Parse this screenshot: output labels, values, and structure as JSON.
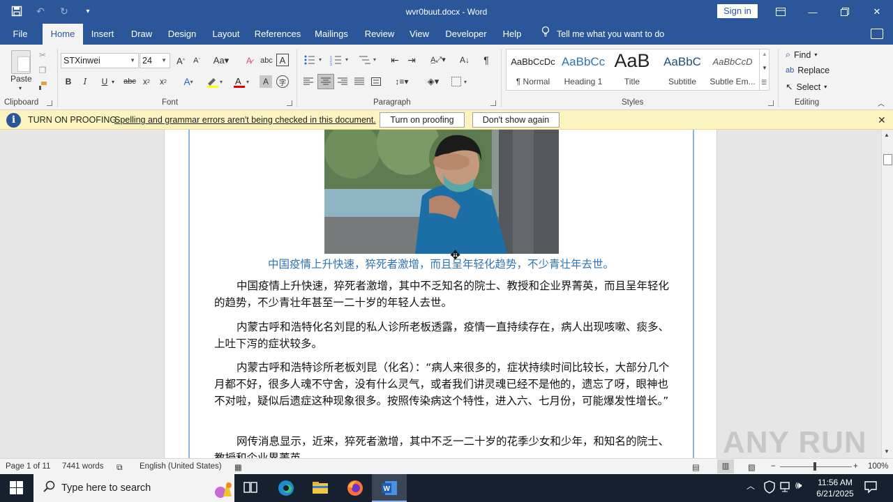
{
  "app": {
    "title": "wvr0buut.docx  -  Word",
    "sign_in": "Sign in"
  },
  "tabs": [
    "File",
    "Home",
    "Insert",
    "Draw",
    "Design",
    "Layout",
    "References",
    "Mailings",
    "Review",
    "View",
    "Developer",
    "Help"
  ],
  "tell_me": "Tell me what you want to do",
  "ribbon": {
    "clipboard": {
      "paste": "Paste",
      "label": "Clipboard"
    },
    "font": {
      "name": "STXinwei",
      "size": "24",
      "label": "Font"
    },
    "paragraph": {
      "label": "Paragraph"
    },
    "styles": {
      "label": "Styles",
      "items": [
        {
          "preview": "AaBbCcDc",
          "name": "¶ Normal"
        },
        {
          "preview": "AaBbCc",
          "name": "Heading 1"
        },
        {
          "preview": "AaB",
          "name": "Title"
        },
        {
          "preview": "AaBbC",
          "name": "Subtitle"
        },
        {
          "preview": "AaBbCcD",
          "name": "Subtle Em..."
        }
      ]
    },
    "editing": {
      "label": "Editing",
      "find": "Find",
      "replace": "Replace",
      "select": "Select"
    }
  },
  "notification": {
    "title": "TURN ON PROOFING",
    "text": "Spelling and grammar errors aren't being checked in this document.",
    "turn_on": "Turn on proofing",
    "dont_show": "Don't show again"
  },
  "document": {
    "caption": "中国疫情上升快速，猝死者激增，而且呈年轻化趋势，不少青壮年去世。",
    "paragraphs": [
      "中国疫情上升快速，猝死者激增，其中不乏知名的院士、教授和企业界菁英，而且呈年轻化的趋势，不少青壮年甚至一二十岁的年轻人去世。",
      "内蒙古呼和浩特化名刘昆的私人诊所老板透露，疫情一直持续存在，病人出现咳嗽、痰多、上吐下泻的症状较多。",
      "内蒙古呼和浩特诊所老板刘昆（化名）：“病人来很多的，症状持续时间比较长，大部分几个月都不好，很多人魂不守舍，没有什么灵气，或者我们讲灵魂已经不是他的，遗忘了呀，眼神也不对啦，疑似后遗症这种现象很多。按照传染病这个特性，进入六、七月份，可能爆发性增长。”",
      "网传消息显示，近来，猝死者激增，其中不乏一二十岁的花季少女和少年，和知名的院士、教授和企业界菁英"
    ]
  },
  "status": {
    "page": "Page 1 of 11",
    "words": "7441 words",
    "language": "English (United States)",
    "zoom": "100%"
  },
  "taskbar": {
    "search_placeholder": "Type here to search",
    "time": "11:56 AM",
    "date": "6/21/2025"
  },
  "watermark": "ANY RUN"
}
